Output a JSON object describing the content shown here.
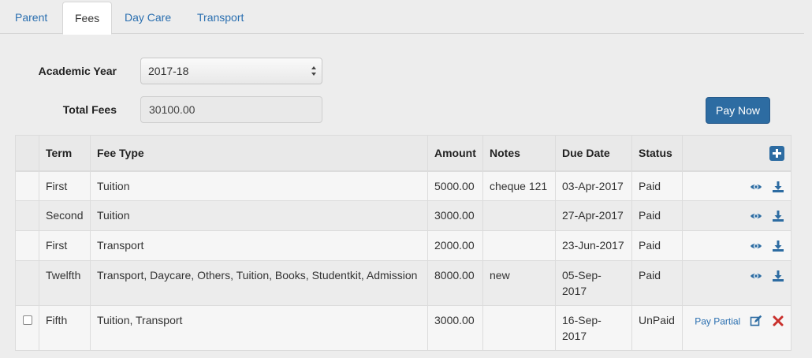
{
  "tabs": [
    {
      "label": "Parent",
      "active": false
    },
    {
      "label": "Fees",
      "active": true
    },
    {
      "label": "Day Care",
      "active": false
    },
    {
      "label": "Transport",
      "active": false
    }
  ],
  "form": {
    "academic_year_label": "Academic Year",
    "academic_year_value": "2017-18",
    "total_fees_label": "Total Fees",
    "total_fees_value": "30100.00",
    "pay_now_label": "Pay Now"
  },
  "table": {
    "columns": [
      "Term",
      "Fee Type",
      "Amount",
      "Notes",
      "Due Date",
      "Status"
    ],
    "rows": [
      {
        "checkbox": false,
        "term": "First",
        "fee_type": "Tuition",
        "amount": "5000.00",
        "notes": "cheque 121",
        "due_date": "03-Apr-2017",
        "status": "Paid",
        "actions": [
          "view-icon",
          "download-icon"
        ]
      },
      {
        "checkbox": false,
        "term": "Second",
        "fee_type": "Tuition",
        "amount": "3000.00",
        "notes": "",
        "due_date": "27-Apr-2017",
        "status": "Paid",
        "actions": [
          "view-icon",
          "download-icon"
        ]
      },
      {
        "checkbox": false,
        "term": "First",
        "fee_type": "Transport",
        "amount": "2000.00",
        "notes": "",
        "due_date": "23-Jun-2017",
        "status": "Paid",
        "actions": [
          "view-icon",
          "download-icon"
        ]
      },
      {
        "checkbox": false,
        "term": "Twelfth",
        "fee_type": "Transport, Daycare, Others, Tuition, Books, Studentkit, Admission",
        "amount": "8000.00",
        "notes": "new",
        "due_date": "05-Sep-2017",
        "status": "Paid",
        "actions": [
          "view-icon",
          "download-icon"
        ]
      },
      {
        "checkbox": true,
        "term": "Fifth",
        "fee_type": "Tuition, Transport",
        "amount": "3000.00",
        "notes": "",
        "due_date": "16-Sep-2017",
        "status": "UnPaid",
        "pay_partial_label": "Pay Partial",
        "actions": [
          "edit-icon",
          "delete-icon"
        ]
      }
    ]
  },
  "colors": {
    "link": "#2a6fb0",
    "primary_button": "#2d6ca2",
    "delete": "#c9302c"
  }
}
